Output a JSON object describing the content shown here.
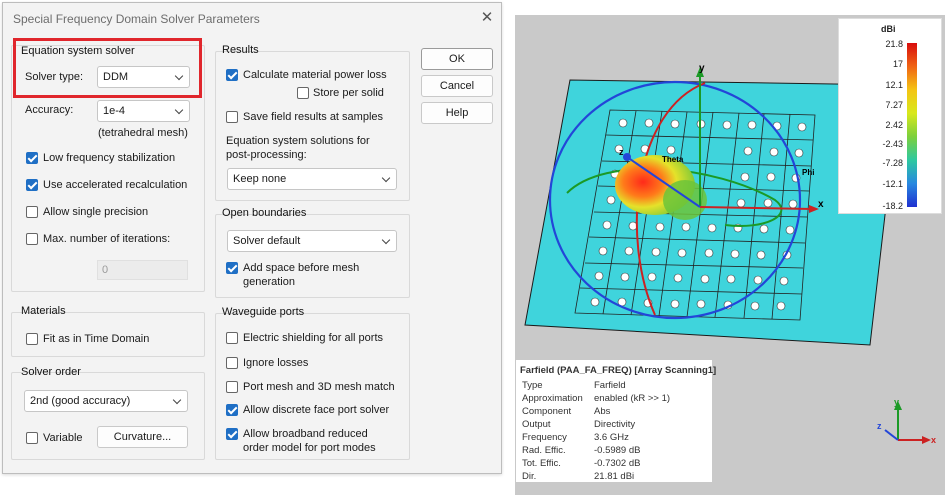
{
  "dialog": {
    "title": "Special Frequency Domain Solver Parameters",
    "close_glyph": "✕",
    "equation_system_solver": {
      "group_label": "Equation system solver",
      "solver_type_label": "Solver type:",
      "solver_type_value": "DDM",
      "accuracy_label": "Accuracy:",
      "accuracy_value": "1e-4",
      "mesh_note": "(tetrahedral mesh)",
      "low_freq_label": "Low frequency stabilization",
      "low_freq_checked": true,
      "accel_recalc_label": "Use accelerated recalculation",
      "accel_recalc_checked": true,
      "single_precision_label": "Allow single precision",
      "single_precision_checked": false,
      "max_iter_label": "Max. number of iterations:",
      "max_iter_checked": false,
      "max_iter_value": "0"
    },
    "materials": {
      "group_label": "Materials",
      "fit_label": "Fit as in Time Domain",
      "fit_checked": false
    },
    "solver_order": {
      "group_label": "Solver order",
      "order_value": "2nd (good accuracy)",
      "variable_label": "Variable",
      "variable_checked": false,
      "curvature_label": "Curvature..."
    },
    "results": {
      "group_label": "Results",
      "calc_power_loss_label": "Calculate material power loss",
      "calc_power_loss_checked": true,
      "store_per_solid_label": "Store per solid",
      "store_per_solid_checked": false,
      "save_field_label": "Save field results at samples",
      "save_field_checked": false,
      "eq_solutions_label_1": "Equation system solutions for",
      "eq_solutions_label_2": "post-processing:",
      "keep_value": "Keep none"
    },
    "open_boundaries": {
      "group_label": "Open boundaries",
      "boundary_value": "Solver default",
      "add_space_label_1": "Add space before mesh",
      "add_space_label_2": "generation",
      "add_space_checked": true
    },
    "waveguide_ports": {
      "group_label": "Waveguide ports",
      "electric_shielding_label": "Electric shielding for all ports",
      "electric_shielding_checked": false,
      "ignore_losses_label": "Ignore losses",
      "ignore_losses_checked": false,
      "port_mesh_label": "Port mesh and 3D mesh match",
      "port_mesh_checked": false,
      "discrete_face_label": "Allow discrete face port solver",
      "discrete_face_checked": true,
      "broadband_label_1": "Allow broadband reduced",
      "broadband_label_2": "order model for port modes",
      "broadband_checked": true
    },
    "buttons": {
      "ok": "OK",
      "cancel": "Cancel",
      "help": "Help"
    }
  },
  "viewport": {
    "axis_labels": {
      "y": "y",
      "x": "x",
      "z": "z",
      "theta": "Theta",
      "phi": "Phi"
    },
    "triad_labels": {
      "y": "y",
      "x": "x",
      "z": "z"
    },
    "legend": {
      "unit": "dBi",
      "ticks": [
        "21.8",
        "17",
        "12.1",
        "7.27",
        "2.42",
        "-2.43",
        "-7.28",
        "-12.1",
        "-18.2"
      ]
    },
    "info": {
      "title": "Farfield (PAA_FA_FREQ) [Array Scanning1]",
      "rows": [
        {
          "k": "Type",
          "v": "Farfield"
        },
        {
          "k": "Approximation",
          "v": "enabled (kR >> 1)"
        },
        {
          "k": "Component",
          "v": "Abs"
        },
        {
          "k": "Output",
          "v": "Directivity"
        },
        {
          "k": "Frequency",
          "v": "3.6 GHz"
        },
        {
          "k": "Rad. Effic.",
          "v": "-0.5989 dB"
        },
        {
          "k": "Tot. Effic.",
          "v": "-0.7302 dB"
        },
        {
          "k": "Dir.",
          "v": "21.81 dBi"
        }
      ]
    }
  },
  "colors": {
    "highlight": "#e0262c",
    "checkbox_on": "#1f6fc5",
    "plate": "#3fd4dc",
    "viewport_bg": "#c9c9c9"
  }
}
